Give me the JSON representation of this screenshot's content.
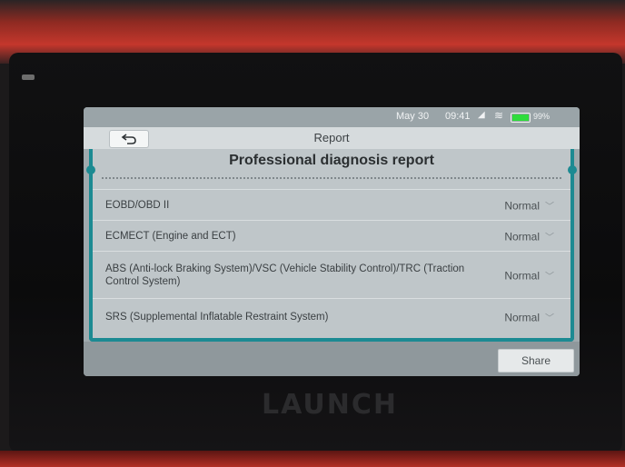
{
  "statusbar": {
    "date": "May 30",
    "time": "09:41",
    "battery_percent": "99%",
    "battery_level": 0.99
  },
  "titlebar": {
    "title": "Report"
  },
  "report": {
    "heading": "Professional diagnosis report",
    "rows": [
      {
        "label": "EOBD/OBD II",
        "status": "Normal"
      },
      {
        "label": "ECMECT (Engine and ECT)",
        "status": "Normal"
      },
      {
        "label": "ABS (Anti-lock Braking System)/VSC (Vehicle Stability Control)/TRC (Traction Control System)",
        "status": "Normal"
      },
      {
        "label": "SRS (Supplemental Inflatable Restraint System)",
        "status": "Normal"
      }
    ]
  },
  "footer": {
    "share_label": "Share"
  },
  "device": {
    "brand": "LAUNCH"
  },
  "colors": {
    "accent": "#1c8a92",
    "battery": "#2fdc3c"
  },
  "icons": {
    "back": "back-arrow-icon",
    "dropdown": "chevron-down-icon",
    "wifi": "wifi-icon",
    "signal": "signal-icon",
    "battery": "battery-icon"
  }
}
